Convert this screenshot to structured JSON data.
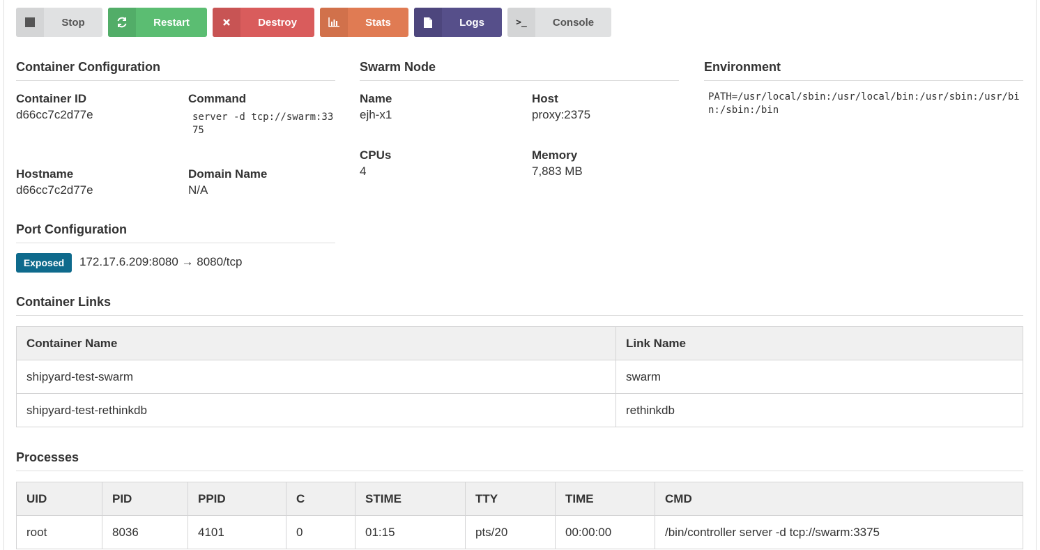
{
  "toolbar": {
    "stop": {
      "label": "Stop",
      "icon": "stop-icon"
    },
    "restart": {
      "label": "Restart",
      "icon": "refresh-icon"
    },
    "destroy": {
      "label": "Destroy",
      "icon": "close-icon"
    },
    "stats": {
      "label": "Stats",
      "icon": "bar-chart-icon"
    },
    "logs": {
      "label": "Logs",
      "icon": "file-icon"
    },
    "console": {
      "label": "Console",
      "icon": "terminal-icon",
      "glyph": ">_"
    }
  },
  "container_config": {
    "title": "Container Configuration",
    "container_id_label": "Container ID",
    "container_id": "d66cc7c2d77e",
    "command_label": "Command",
    "command": "server -d tcp://swarm:3375",
    "hostname_label": "Hostname",
    "hostname": "d66cc7c2d77e",
    "domain_label": "Domain Name",
    "domain": "N/A"
  },
  "swarm_node": {
    "title": "Swarm Node",
    "name_label": "Name",
    "name": "ejh-x1",
    "host_label": "Host",
    "host": "proxy:2375",
    "cpus_label": "CPUs",
    "cpus": "4",
    "memory_label": "Memory",
    "memory": "7,883 MB"
  },
  "environment": {
    "title": "Environment",
    "value": "PATH=/usr/local/sbin:/usr/local/bin:/usr/sbin:/usr/bin:/sbin:/bin"
  },
  "port_config": {
    "title": "Port Configuration",
    "badge": "Exposed",
    "mapping": "172.17.6.209:8080 → 8080/tcp"
  },
  "container_links": {
    "title": "Container Links",
    "headers": [
      "Container Name",
      "Link Name"
    ],
    "rows": [
      [
        "shipyard-test-swarm",
        "swarm"
      ],
      [
        "shipyard-test-rethinkdb",
        "rethinkdb"
      ]
    ]
  },
  "processes": {
    "title": "Processes",
    "headers": [
      "UID",
      "PID",
      "PPID",
      "C",
      "STIME",
      "TTY",
      "TIME",
      "CMD"
    ],
    "rows": [
      [
        "root",
        "8036",
        "4101",
        "0",
        "01:15",
        "pts/20",
        "00:00:00",
        "/bin/controller server -d tcp://swarm:3375"
      ]
    ]
  },
  "colors": {
    "restart": "#5bbd72",
    "destroy": "#d95c5c",
    "stats": "#e07b53",
    "logs": "#564f8a",
    "badge": "#0e6a8c"
  }
}
